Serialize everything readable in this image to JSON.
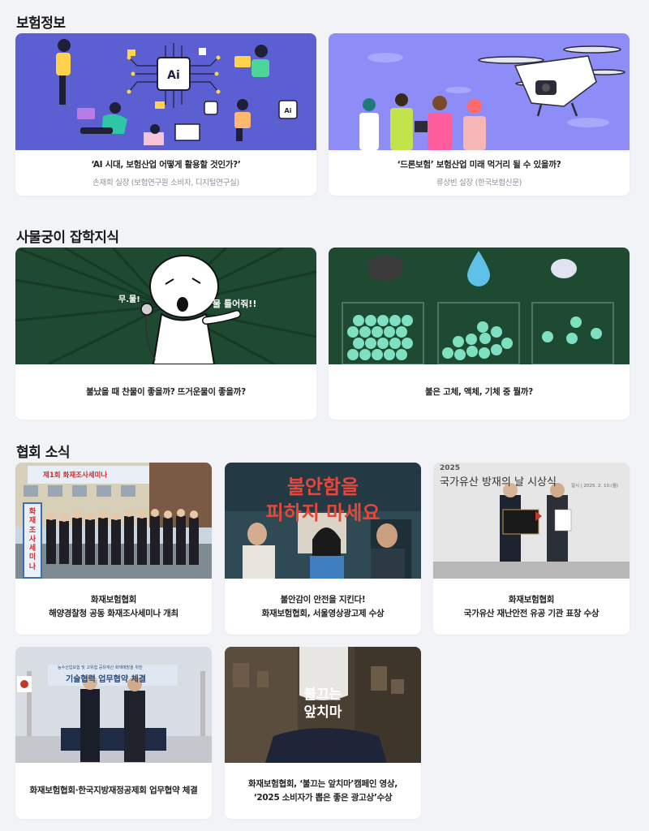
{
  "sections": {
    "insurance_info": "보험정보",
    "trivia": "사물궁이 잡학지식",
    "news": "협회 소식"
  },
  "insurance_cards": [
    {
      "title": "‘AI 시대, 보험산업 어떻게 활용할 것인가?’",
      "subtitle": "손재희 실장 (보험연구원 소비자, 디지털연구실)"
    },
    {
      "title": "‘드론보험’ 보험산업 미래 먹거리 될 수 있을까?",
      "subtitle": "류상빈 실장 (한국보험신문)"
    }
  ],
  "trivia_cards": [
    {
      "title": "불났을 때 찬물이 좋을까? 뜨거운물이 좋을까?",
      "speech_left": "무.물!",
      "speech_right": "물 틀어줘!!"
    },
    {
      "title": "불은 고체, 액체, 기체 중 뭘까?"
    }
  ],
  "news_cards": [
    {
      "title_line1": "화재보험협회",
      "title_line2": "해양경찰청 공동 화재조사세미나 개최",
      "banner": "제1회 화재조사세미나",
      "side_banner": "화재조사세미나"
    },
    {
      "title_line1": "불안감이 안전을 지킨다!",
      "title_line2": "화재보험협회, 서울영상광고제 수상",
      "poster_line1": "불안함을",
      "poster_line2": "피하지 마세요"
    },
    {
      "title_line1": "화재보험협회",
      "title_line2": "국가유산 재난안전 유공 기관 표창 수상",
      "ceremony_year": "2025",
      "ceremony_title": "국가유산 방재의 날 시상식",
      "ceremony_date": "일시 | 2025. 2. 10.(월)"
    },
    {
      "title_line1": "화재보험협회·한국지방재정공제회 업무협약 체결",
      "title_line2": "",
      "banner_small": "능수산업보험 및 고위험 공유재산 화재예방을 위한",
      "banner_big": "기술협력 업무협약 체결"
    },
    {
      "title_line1": "화재보험협회, ‘불끄는 앞치마’캠페인 영상,",
      "title_line2": "‘2025 소비자가 뽑은 좋은 광고상’수상",
      "overlay_line1": "불끄는",
      "overlay_line2": "앞치마"
    }
  ],
  "colors": {
    "ai_bg": "#5b5fd1",
    "drone_bg": "#8e8df7",
    "green_bg": "#1e4a31",
    "page_bg": "#f1f3f6"
  }
}
